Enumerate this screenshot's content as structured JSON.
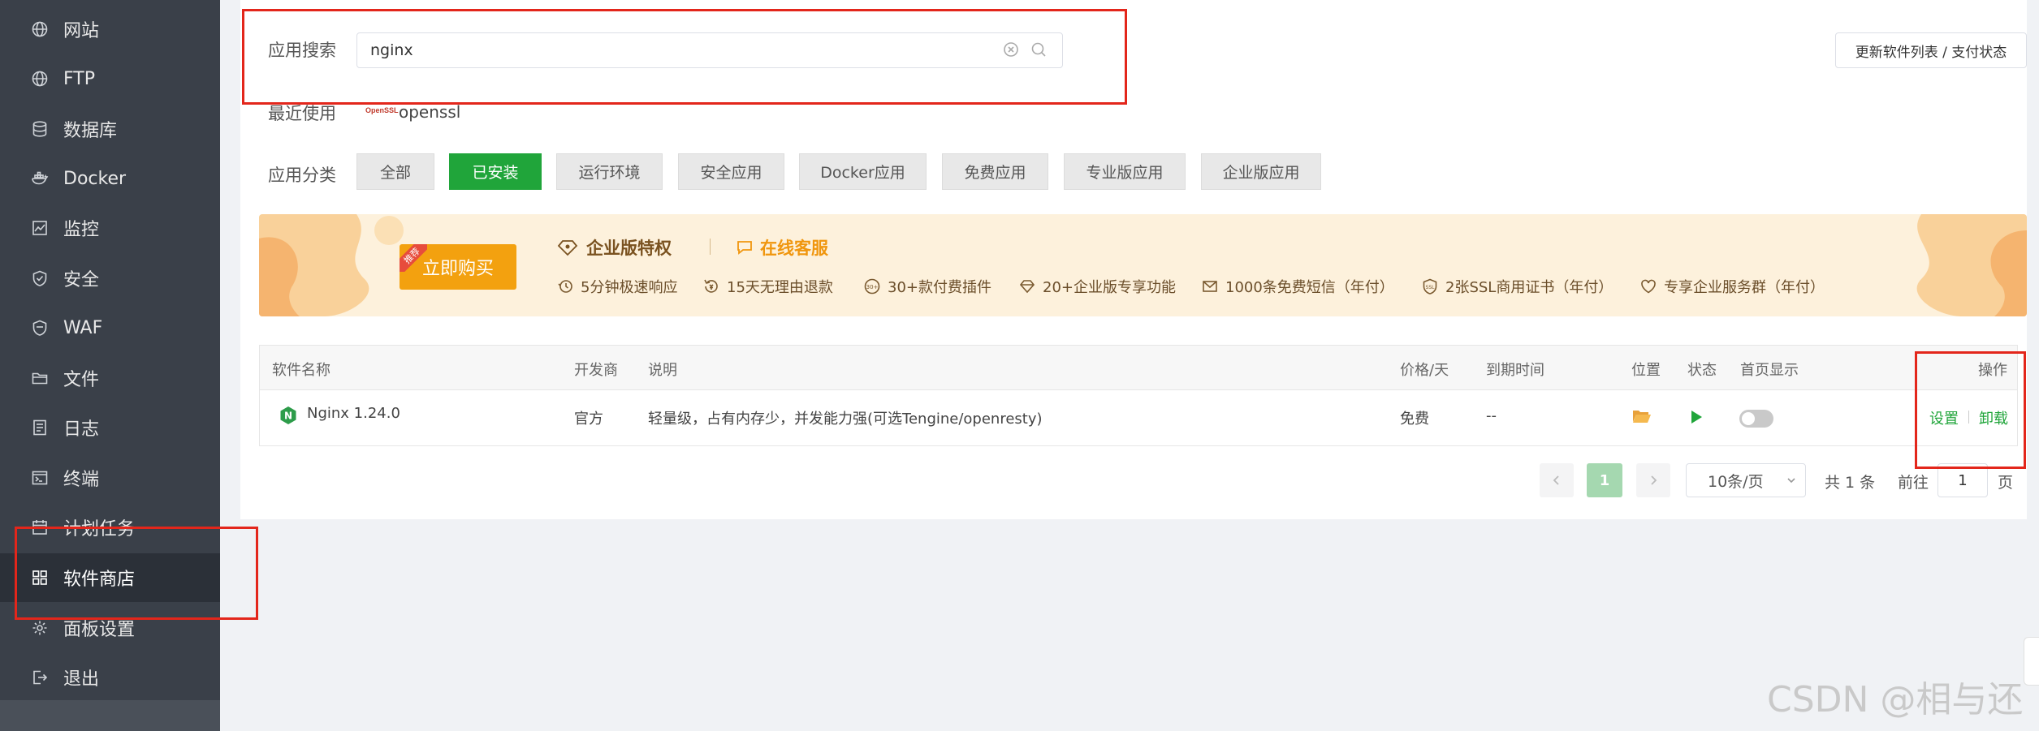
{
  "sidebar": {
    "items": [
      {
        "label": "网站",
        "icon": "globe-icon"
      },
      {
        "label": "FTP",
        "icon": "globe-icon"
      },
      {
        "label": "数据库",
        "icon": "database-icon"
      },
      {
        "label": "Docker",
        "icon": "docker-icon"
      },
      {
        "label": "监控",
        "icon": "monitor-icon"
      },
      {
        "label": "安全",
        "icon": "shield-icon"
      },
      {
        "label": "WAF",
        "icon": "waf-shield-icon"
      },
      {
        "label": "文件",
        "icon": "folder-icon"
      },
      {
        "label": "日志",
        "icon": "log-icon"
      },
      {
        "label": "终端",
        "icon": "terminal-icon"
      },
      {
        "label": "计划任务",
        "icon": "calendar-icon"
      },
      {
        "label": "软件商店",
        "icon": "grid-icon"
      },
      {
        "label": "面板设置",
        "icon": "gear-icon"
      },
      {
        "label": "退出",
        "icon": "logout-icon"
      }
    ],
    "active": "软件商店"
  },
  "search": {
    "label": "应用搜索",
    "value": "nginx"
  },
  "update_button": "更新软件列表 / 支付状态",
  "recent": {
    "label": "最近使用",
    "logo_text": "OpenSSL",
    "item": "openssl"
  },
  "categories": {
    "label": "应用分类",
    "items": [
      "全部",
      "已安装",
      "运行环境",
      "安全应用",
      "Docker应用",
      "免费应用",
      "专业版应用",
      "企业版应用"
    ],
    "active": "已安装"
  },
  "banner": {
    "tag": "推荐",
    "buy_label": "立即购买",
    "enterprise_title": "企业版特权",
    "service_label": "在线客服",
    "features": [
      "5分钟极速响应",
      "15天无理由退款",
      "30+款付费插件",
      "20+企业版专享功能",
      "1000条免费短信（年付）",
      "2张SSL商用证书（年付）",
      "专享企业服务群（年付）"
    ],
    "icon_text_30": "30+",
    "icon_text_ssl": "SSL"
  },
  "table": {
    "headers": {
      "name": "软件名称",
      "developer": "开发商",
      "description": "说明",
      "price": "价格/天",
      "expire": "到期时间",
      "location": "位置",
      "status": "状态",
      "homepage": "首页显示",
      "actions": "操作"
    },
    "rows": [
      {
        "logo_letter": "N",
        "name": "Nginx 1.24.0",
        "developer": "官方",
        "description": "轻量级，占有内存少，并发能力强(可选Tengine/openresty)",
        "price": "免费",
        "expire": "--",
        "homepage_enabled": false,
        "action_settings": "设置",
        "action_uninstall": "卸载"
      }
    ]
  },
  "pagination": {
    "current_page": "1",
    "page_size": "10条/页",
    "total": "共 1 条",
    "goto_label": "前往",
    "goto_value": "1",
    "page_suffix": "页"
  },
  "watermark": "CSDN @相与还",
  "colors": {
    "sidebar_bg": "#3a4049",
    "accent_green": "#20a53a",
    "banner_bg": "#fdf1dc",
    "buy_orange": "#f3a10f",
    "annotation_red": "#e3261b"
  }
}
